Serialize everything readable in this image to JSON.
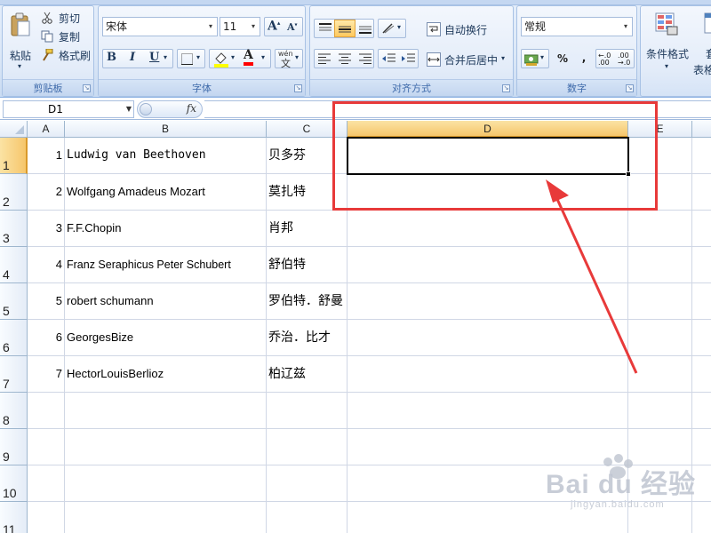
{
  "ribbon": {
    "clipboard": {
      "label": "剪贴板",
      "paste": "粘贴",
      "cut": "剪切",
      "copy": "复制",
      "format_painter": "格式刷"
    },
    "font": {
      "label": "字体",
      "name": "宋体",
      "size": "11",
      "bold": "B",
      "italic": "I",
      "underline": "U",
      "phonetic": "wén",
      "phonetic_char": "文"
    },
    "alignment": {
      "label": "对齐方式",
      "wrap_text": "自动换行",
      "merge_center": "合并后居中"
    },
    "number": {
      "label": "数字",
      "format": "常规",
      "percent": "%",
      "comma": ","
    },
    "styles": {
      "conditional_format": "条件格式",
      "table_format_partial": "套",
      "table_format_sub": "表格"
    }
  },
  "formula_bar": {
    "name_box": "D1",
    "fx": "fx",
    "content": ""
  },
  "grid": {
    "columns": [
      "A",
      "B",
      "C",
      "D",
      "E"
    ],
    "selected_column": "D",
    "rows": [
      "1",
      "2",
      "3",
      "4",
      "5",
      "6",
      "7",
      "8",
      "9",
      "10",
      "11"
    ],
    "selected_row": "1",
    "data": [
      {
        "a": "1",
        "b": "Ludwig van Beethoven",
        "c": "贝多芬"
      },
      {
        "a": "2",
        "b": "Wolfgang Amadeus Mozart",
        "c": "莫扎特"
      },
      {
        "a": "3",
        "b": "F.F.Chopin",
        "c": "肖邦"
      },
      {
        "a": "4",
        "b": "Franz Seraphicus Peter Schubert",
        "c": "舒伯特"
      },
      {
        "a": "5",
        "b": "robert schumann",
        "c": "罗伯特．舒曼"
      },
      {
        "a": "6",
        "b": "GeorgesBize",
        "c": "乔治．比才"
      },
      {
        "a": "7",
        "b": "HectorLouisBerlioz",
        "c": "柏辽兹"
      }
    ]
  },
  "watermark": {
    "brand": "Bai du 经验",
    "url": "jingyan.baidu.com"
  },
  "colors": {
    "annotation": "#e83a3a",
    "selected_header": "#f6c66b",
    "ribbon_text": "#15428b"
  }
}
